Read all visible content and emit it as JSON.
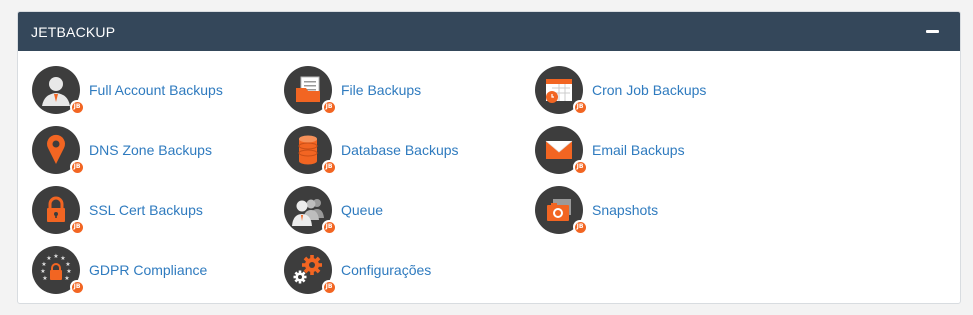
{
  "panel": {
    "title": "JETBACKUP",
    "collapse_icon": "minus-icon"
  },
  "colors": {
    "header_bg": "#34475a",
    "icon_circle": "#3d3d3d",
    "accent_orange": "#f26522",
    "link_blue": "#2f7bbf"
  },
  "badge_text": "JB",
  "items": [
    {
      "label": "Full Account Backups",
      "icon": "user-account-icon"
    },
    {
      "label": "File Backups",
      "icon": "files-icon"
    },
    {
      "label": "Cron Job Backups",
      "icon": "calendar-clock-icon"
    },
    {
      "label": "DNS Zone Backups",
      "icon": "map-pin-icon"
    },
    {
      "label": "Database Backups",
      "icon": "database-icon"
    },
    {
      "label": "Email Backups",
      "icon": "envelope-icon"
    },
    {
      "label": "SSL Cert Backups",
      "icon": "padlock-icon"
    },
    {
      "label": "Queue",
      "icon": "users-queue-icon"
    },
    {
      "label": "Snapshots",
      "icon": "camera-icon"
    },
    {
      "label": "GDPR Compliance",
      "icon": "eu-stars-lock-icon"
    },
    {
      "label": "Configurações",
      "icon": "gears-icon"
    }
  ]
}
